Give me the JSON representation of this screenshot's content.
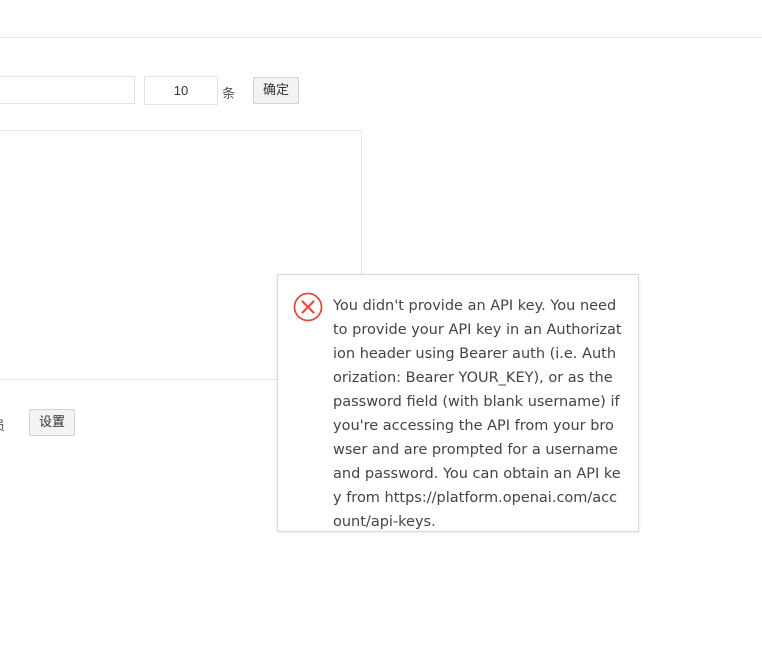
{
  "toolbar": {
    "search_value": "",
    "count_value": "10",
    "count_unit": "条",
    "confirm_label": "确定"
  },
  "settings": {
    "role_label": "员",
    "settings_label": "设置"
  },
  "error_dialog": {
    "icon": "close-circle-icon",
    "accent_color": "#e74c3c",
    "message": "You didn't provide an API key. You need to provide your API key in an Authorization header using Bearer auth (i.e. Authorization: Bearer YOUR_KEY), or as the password field (with blank username) if you're accessing the API from your browser and are prompted for a username and password. You can obtain an API key from https://platform.openai.com/account/api-keys."
  }
}
